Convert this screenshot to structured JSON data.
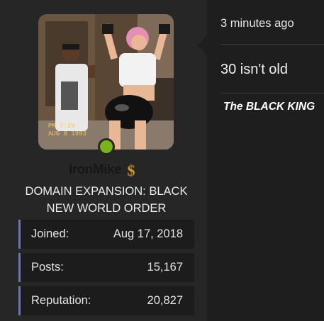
{
  "user": {
    "username": "IronMike",
    "title": "DOMAIN EXPANSION: BLACK NEW WORLD ORDER",
    "avatar_icon": "user-avatar-photo",
    "badge_icon": "dollar-sign-icon",
    "online_color": "#7ab317",
    "stats": [
      {
        "label": "Joined:",
        "value": "Aug 17, 2018"
      },
      {
        "label": "Posts:",
        "value": "15,167"
      },
      {
        "label": "Reputation:",
        "value": "20,827"
      }
    ]
  },
  "post": {
    "time": "3 minutes ago",
    "body": "30 isn't old",
    "signature": "The BLACK KING"
  },
  "colors": {
    "accent_bar": "#6a76b8",
    "dollar": "#d8a635",
    "background": "#1e1e1e"
  }
}
